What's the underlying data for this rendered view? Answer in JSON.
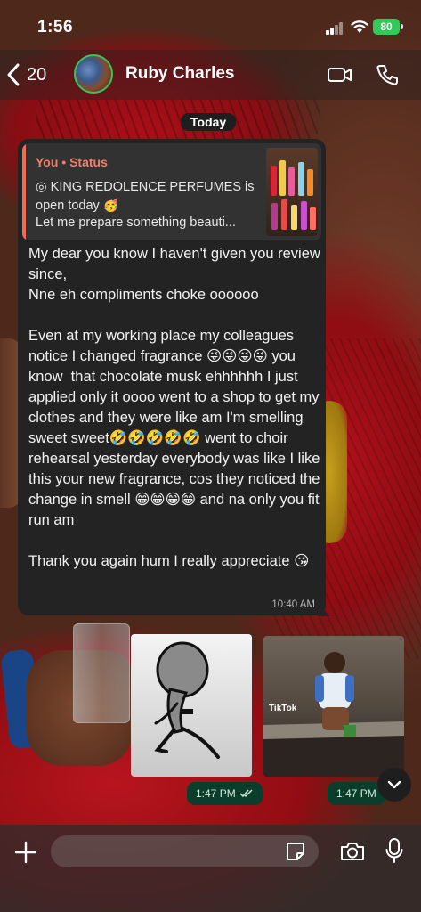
{
  "status_bar": {
    "time": "1:56",
    "battery": "80"
  },
  "header": {
    "back_count": "20",
    "contact_name": "Ruby Charles",
    "icons": [
      "chevron-left-icon",
      "video-call-icon",
      "phone-icon"
    ]
  },
  "date_divider": "Today",
  "quoted_status": {
    "author": "You • Status",
    "line1": "◎ KING REDOLENCE PERFUMES is",
    "line2": "open today 🥳",
    "line3": "Let me prepare something beauti..."
  },
  "message": {
    "text": "My dear you know I haven't given you review since,\nNne eh compliments choke oooooo\n\nEven at my working place my colleagues notice I changed fragrance 😜😜😜😜 you know  that chocolate musk ehhhhhh I just applied only it oooo went to a shop to get my clothes and they were like am I'm smelling sweet sweet🤣🤣🤣🤣🤣 went to choir rehearsal yesterday everybody was like I like this your new fragrance, cos they noticed the change in smell 😁😁😁😁 and na only you fit run am\n\nThank you again hum I really appreciate 😘",
    "time": "10:40 AM"
  },
  "media": [
    {
      "type": "sticker",
      "time": "1:47 PM",
      "status": "read"
    },
    {
      "type": "video",
      "time": "1:47 PM",
      "overlay": "TikTok"
    }
  ],
  "input": {
    "placeholder": ""
  },
  "colors": {
    "accent_green": "#35c759",
    "quote_author": "#f47d68",
    "bubble": "#232323",
    "time_pill": "#0b3d2c"
  }
}
